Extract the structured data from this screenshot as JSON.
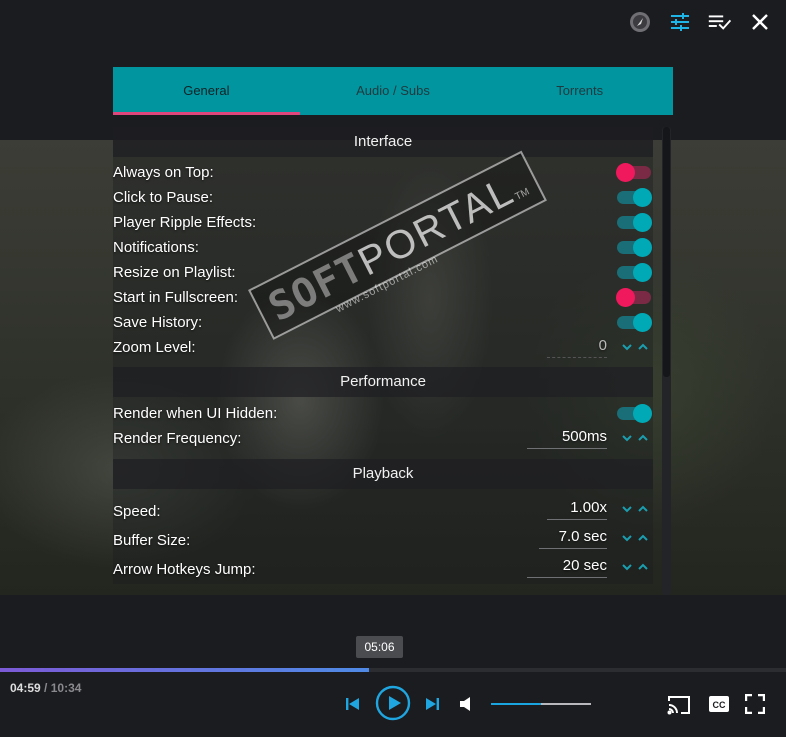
{
  "tabs": [
    {
      "label": "General",
      "active": true
    },
    {
      "label": "Audio / Subs",
      "active": false
    },
    {
      "label": "Torrents",
      "active": false
    }
  ],
  "sections": {
    "interface": "Interface",
    "performance": "Performance",
    "playback": "Playback"
  },
  "interface_rows": {
    "always_on_top": {
      "label": "Always on Top:",
      "on": false
    },
    "click_to_pause": {
      "label": "Click to Pause:",
      "on": true
    },
    "ripple": {
      "label": "Player Ripple Effects:",
      "on": true
    },
    "notifications": {
      "label": "Notifications:",
      "on": true
    },
    "resize_playlist": {
      "label": "Resize on Playlist:",
      "on": true
    },
    "start_fullscreen": {
      "label": "Start in Fullscreen:",
      "on": false
    },
    "save_history": {
      "label": "Save History:",
      "on": true
    },
    "zoom_level": {
      "label": "Zoom Level:",
      "value": "0"
    }
  },
  "performance_rows": {
    "render_hidden": {
      "label": "Render when UI Hidden:",
      "on": true
    },
    "render_freq": {
      "label": "Render Frequency:",
      "value": "500ms"
    }
  },
  "playback_rows": {
    "speed": {
      "label": "Speed:",
      "value": "1.00x"
    },
    "buffer": {
      "label": "Buffer Size:",
      "value": "7.0 sec"
    },
    "arrow_jump": {
      "label": "Arrow Hotkeys Jump:",
      "value": "20 sec"
    }
  },
  "watermark": {
    "brand_a": "SOFT",
    "brand_b": "PORTAL",
    "tm": "TM",
    "url": "www.softportal.com"
  },
  "player": {
    "tooltip": "05:06",
    "current_time": "04:59",
    "separator": " / ",
    "total_time": "10:34",
    "progress": 0.47,
    "volume": 0.5
  },
  "colors": {
    "accent": "#00959f",
    "tab_indicator": "#e0457b",
    "toggle_on": "#00a9b6",
    "toggle_off": "#f0195e",
    "progress": "#5b7ee0"
  },
  "icons": [
    "web-player-icon",
    "settings-sliders-icon",
    "playlist-check-icon",
    "close-icon",
    "skip-previous-icon",
    "play-icon",
    "skip-next-icon",
    "volume-icon",
    "cast-icon",
    "subtitles-icon",
    "fullscreen-icon",
    "chevron-down-icon",
    "chevron-up-icon"
  ]
}
